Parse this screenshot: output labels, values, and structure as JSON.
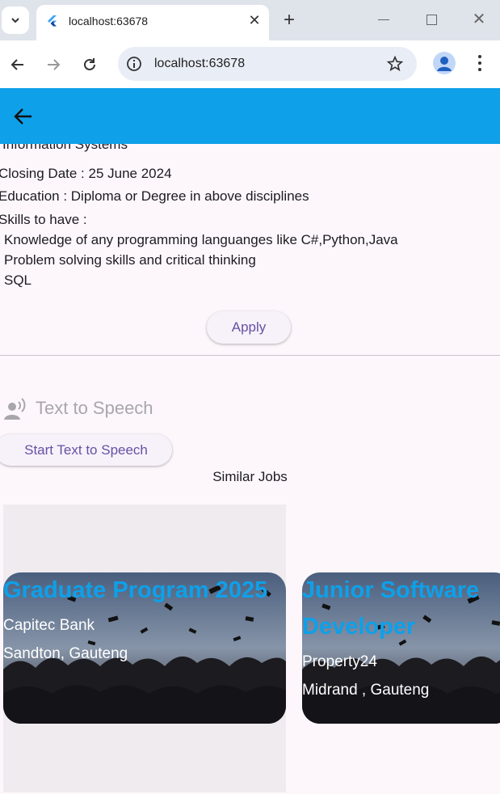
{
  "browser": {
    "tab_title": "localhost:63678",
    "address": "localhost:63678"
  },
  "details": {
    "partial_line": "Information Systems",
    "closing_date": "Closing Date : 25 June 2024",
    "education": "Education : Diploma or Degree in above disciplines",
    "skills_heading": "Skills to have :",
    "skills": [
      "Knowledge of any programming languanges like C#,Python,Java",
      "Problem solving skills and critical thinking",
      "SQL"
    ],
    "apply_label": "Apply"
  },
  "tts": {
    "label": "Text to Speech",
    "button_label": "Start Text to Speech"
  },
  "similar": {
    "heading": "Similar Jobs",
    "jobs": [
      {
        "title": "Graduate Program 2025",
        "company": "Capitec Bank",
        "location": "Sandton, Gauteng"
      },
      {
        "title_line1": "Junior Software",
        "title_line2": "Developer",
        "company": "Property24",
        "location": "Midrand , Gauteng"
      }
    ]
  },
  "colors": {
    "appbar": "#0ea0e9",
    "accent_text": "#6750a4",
    "job_title": "#0ea0e9"
  }
}
